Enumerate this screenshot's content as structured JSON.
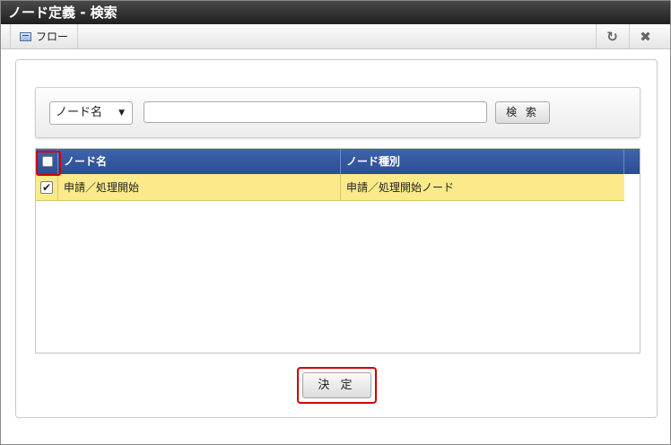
{
  "window": {
    "title": "ノード定義 - 検索"
  },
  "toolbar": {
    "flow_label": "フロー",
    "flow_icon": "flow-icon",
    "refresh_icon": "refresh-icon",
    "close_icon": "close-icon"
  },
  "search": {
    "field_select": "ノード名",
    "query_value": "",
    "button_label": "検 索"
  },
  "grid": {
    "columns": [
      "ノード名",
      "ノード種別"
    ],
    "rows": [
      {
        "checked": true,
        "node_name": "申請／処理開始",
        "node_type": "申請／処理開始ノード"
      }
    ]
  },
  "footer": {
    "decide_label": "決 定"
  },
  "colors": {
    "header_blue": "#2c4d92",
    "selected_row": "#fbea8a",
    "highlight_red": "#cc0000"
  }
}
